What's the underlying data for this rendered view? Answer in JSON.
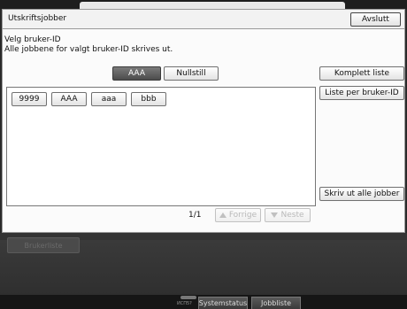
{
  "header": {
    "title": "Utskriftsjobber",
    "exit_label": "Avslutt"
  },
  "instructions": {
    "line1": "Velg bruker-ID",
    "line2": "Alle jobbene for valgt bruker-ID skrives ut."
  },
  "selection": {
    "selected_user": "AAA",
    "reset_label": "Nullstill"
  },
  "user_ids": [
    "9999",
    "AAA",
    "aaa",
    "bbb"
  ],
  "side_buttons": {
    "full_list": "Komplett liste",
    "list_per_user": "Liste per bruker-ID",
    "print_all": "Skriv ut alle jobber"
  },
  "pagination": {
    "page": "1/1",
    "prev_label": "Forrige",
    "next_label": "Neste"
  },
  "dimmed_button_label": "Brukerliste",
  "bottom_bar": {
    "indicator_text": "ИCП5?",
    "tabs": [
      "Systemstatus",
      "Jobbliste"
    ]
  }
}
